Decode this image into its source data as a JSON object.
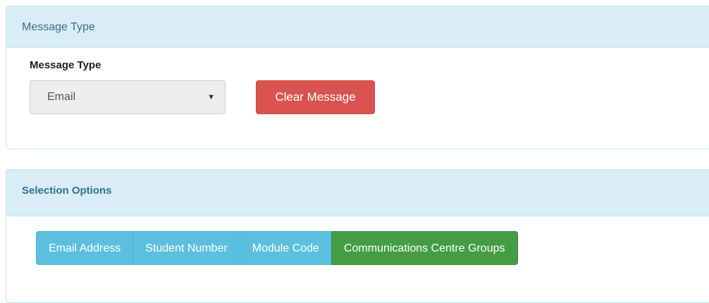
{
  "message_type_panel": {
    "heading": "Message Type",
    "field_label": "Message Type",
    "select": {
      "value": "Email",
      "arrow": "▼"
    },
    "clear_button": "Clear Message"
  },
  "selection_panel": {
    "heading": "Selection Options",
    "options": [
      {
        "label": "Email Address",
        "active": false
      },
      {
        "label": "Student Number",
        "active": false
      },
      {
        "label": "Module Code",
        "active": false
      },
      {
        "label": "Communications Centre Groups",
        "active": true
      }
    ]
  },
  "colors": {
    "panel_heading_bg": "#d9edf7",
    "panel_heading_text": "#31708f",
    "danger": "#d9534f",
    "info": "#5bc0de",
    "success_active": "#449d44"
  }
}
